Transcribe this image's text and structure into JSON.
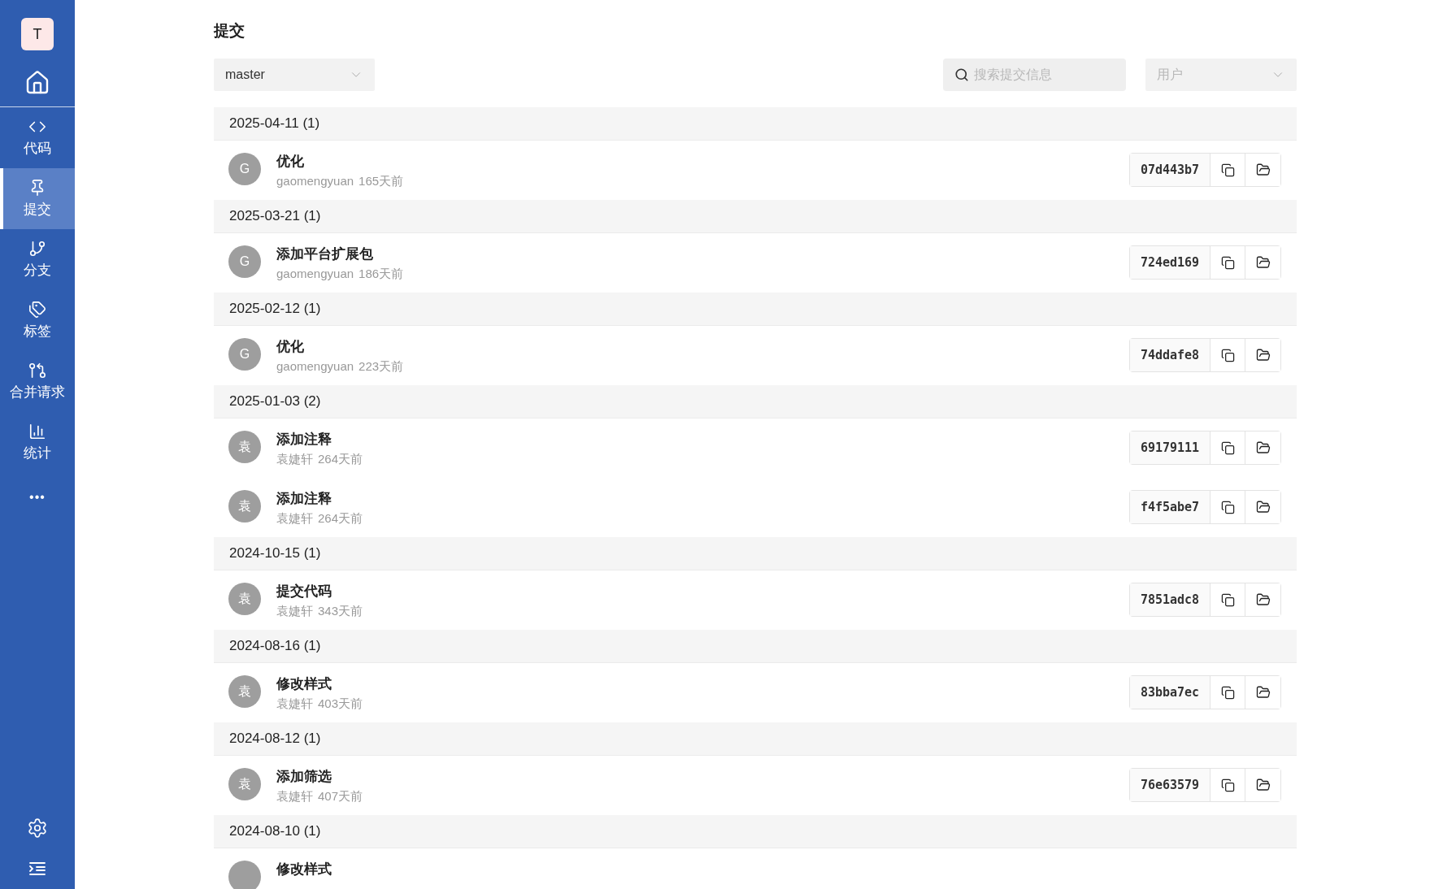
{
  "sidebar": {
    "avatar": "T",
    "items": [
      {
        "kind": "code",
        "label": "代码",
        "selected": false
      },
      {
        "kind": "commit",
        "label": "提交",
        "selected": true
      },
      {
        "kind": "branch",
        "label": "分支",
        "selected": false
      },
      {
        "kind": "tag",
        "label": "标签",
        "selected": false
      },
      {
        "kind": "merge",
        "label": "合并请求",
        "selected": false
      },
      {
        "kind": "stats",
        "label": "统计",
        "selected": false
      },
      {
        "kind": "more",
        "label": "•••",
        "selected": false
      }
    ]
  },
  "page": {
    "title": "提交",
    "branch": "master",
    "search": {
      "placeholder": "搜索提交信息"
    },
    "user_filter": {
      "placeholder": "用户"
    }
  },
  "groups": [
    {
      "date": "2025-04-11 (1)",
      "commits": [
        {
          "avatar": "G",
          "title": "优化",
          "author": "gaomengyuan",
          "age": "165天前",
          "hash": "07d443b7"
        }
      ]
    },
    {
      "date": "2025-03-21 (1)",
      "commits": [
        {
          "avatar": "G",
          "title": "添加平台扩展包",
          "author": "gaomengyuan",
          "age": "186天前",
          "hash": "724ed169"
        }
      ]
    },
    {
      "date": "2025-02-12 (1)",
      "commits": [
        {
          "avatar": "G",
          "title": "优化",
          "author": "gaomengyuan",
          "age": "223天前",
          "hash": "74ddafe8"
        }
      ]
    },
    {
      "date": "2025-01-03 (2)",
      "commits": [
        {
          "avatar": "袁",
          "title": "添加注释",
          "author": "袁婕轩",
          "age": "264天前",
          "hash": "69179111"
        },
        {
          "avatar": "袁",
          "title": "添加注释",
          "author": "袁婕轩",
          "age": "264天前",
          "hash": "f4f5abe7"
        }
      ]
    },
    {
      "date": "2024-10-15 (1)",
      "commits": [
        {
          "avatar": "袁",
          "title": "提交代码",
          "author": "袁婕轩",
          "age": "343天前",
          "hash": "7851adc8"
        }
      ]
    },
    {
      "date": "2024-08-16 (1)",
      "commits": [
        {
          "avatar": "袁",
          "title": "修改样式",
          "author": "袁婕轩",
          "age": "403天前",
          "hash": "83bba7ec"
        }
      ]
    },
    {
      "date": "2024-08-12 (1)",
      "commits": [
        {
          "avatar": "袁",
          "title": "添加筛选",
          "author": "袁婕轩",
          "age": "407天前",
          "hash": "76e63579"
        }
      ]
    },
    {
      "date": "2024-08-10 (1)",
      "commits": [
        {
          "title": "修改样式"
        }
      ]
    }
  ]
}
